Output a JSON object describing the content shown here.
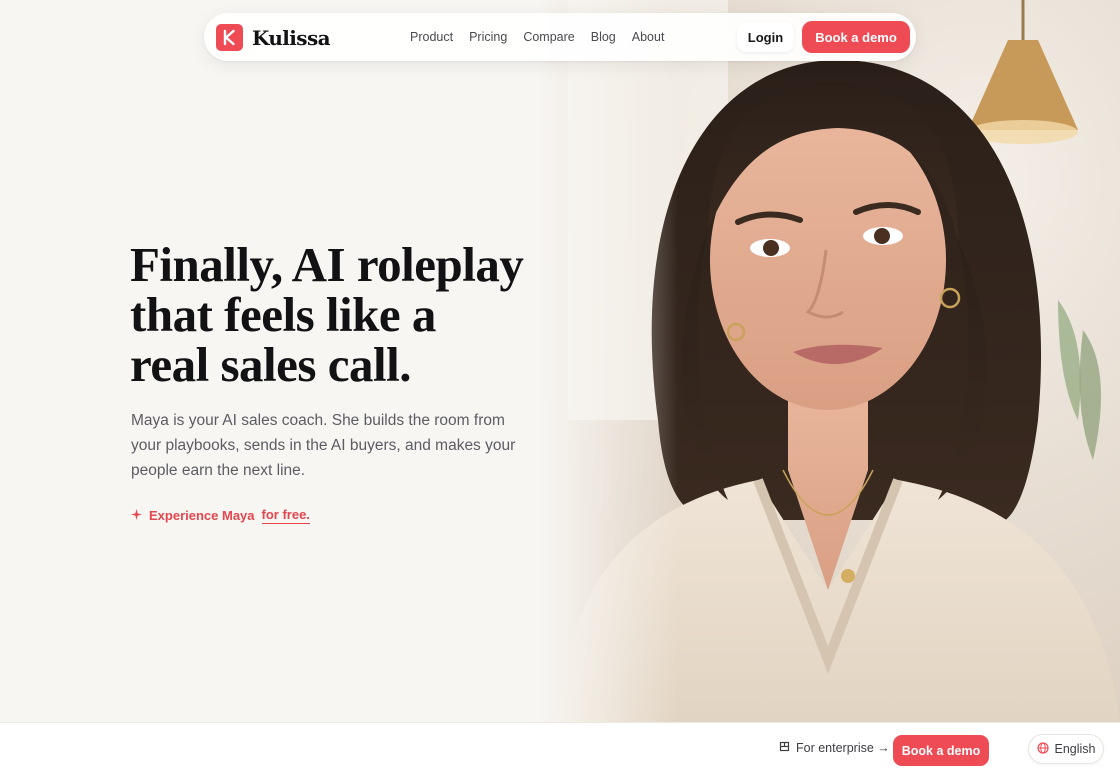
{
  "brand": {
    "name": "Kulissa",
    "logo_icon": "k-logo-icon",
    "accent_color": "#ef4b55"
  },
  "nav": {
    "links": [
      "Product",
      "Pricing",
      "Compare",
      "Blog",
      "About"
    ],
    "login_label": "Login",
    "demo_label": "Book a demo"
  },
  "hero": {
    "headline_lines": [
      "Finally, AI roleplay",
      "that feels like a",
      "real sales call."
    ],
    "subtext": "Maya is your AI sales coach. She builds the room from your playbooks, sends in the AI buyers, and makes your people earn the next line.",
    "cta": {
      "icon": "sparkle-icon",
      "label_main": "Experience Maya",
      "label_underlined": "for free."
    },
    "image": "portrait-photo"
  },
  "footer_bar": {
    "enterprise_icon": "building-icon",
    "enterprise_label": "For enterprise →",
    "demo_label": "Book a demo",
    "language_icon": "globe-icon",
    "language_label": "English"
  }
}
